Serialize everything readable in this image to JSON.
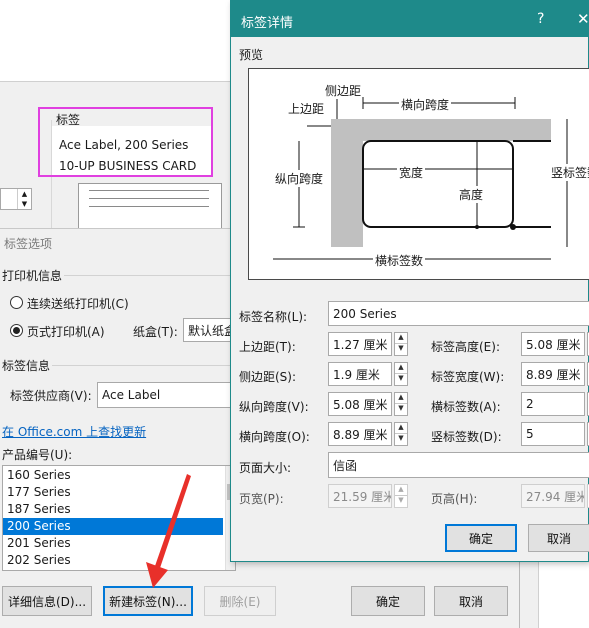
{
  "back_window": {
    "labels_group_title": "标签",
    "selected_label_line1": "Ace Label, 200 Series",
    "selected_label_line2": "10-UP BUSINESS CARD"
  },
  "label_options": {
    "title": "标签选项",
    "printer_info": "打印机信息",
    "continuous_printer": "连续送纸打印机(C)",
    "page_printer": "页式打印机(A)",
    "tray_label": "纸盒(T):",
    "tray_value": "默认纸盒",
    "label_info": "标签信息",
    "vendor_label": "标签供应商(V):",
    "vendor_value": "Ace Label",
    "office_link": "在 Office.com 上查找更新",
    "product_number_label": "产品编号(U):",
    "product_list": [
      "160 Series",
      "177 Series",
      "187 Series",
      "200 Series",
      "201 Series",
      "202 Series"
    ],
    "selected_index": 3,
    "details_button": "详细信息(D)...",
    "new_label_button": "新建标签(N)...",
    "delete_button": "删除(E)",
    "ok_button": "确定",
    "cancel_button": "取消"
  },
  "label_details": {
    "title": "标签详情",
    "help_icon": "?",
    "close_icon": "✕",
    "preview_group": "预览",
    "preview": {
      "top_margin": "上边距",
      "side_margin": "侧边距",
      "horizontal_pitch": "横向跨度",
      "vertical_pitch": "纵向跨度",
      "width": "宽度",
      "height": "高度",
      "number_across": "横标签数",
      "number_down": "竖标签数"
    },
    "label_name_label": "标签名称(L):",
    "label_name_value": "200 Series",
    "top_margin_label": "上边距(T):",
    "top_margin_value": "1.27 厘米",
    "side_margin_label": "侧边距(S):",
    "side_margin_value": "1.9 厘米",
    "vertical_pitch_label": "纵向跨度(V):",
    "vertical_pitch_value": "5.08 厘米",
    "horizontal_pitch_label": "横向跨度(O):",
    "horizontal_pitch_value": "8.89 厘米",
    "label_height_label": "标签高度(E):",
    "label_height_value": "5.08 厘米",
    "label_width_label": "标签宽度(W):",
    "label_width_value": "8.89 厘米",
    "number_across_label": "横标签数(A):",
    "number_across_value": "2",
    "number_down_label": "竖标签数(D):",
    "number_down_value": "5",
    "page_size_label": "页面大小:",
    "page_size_value": "信函",
    "page_width_label": "页宽(P):",
    "page_width_value": "21.59 厘米",
    "page_height_label": "页高(H):",
    "page_height_value": "27.94 厘米",
    "ok_button": "确定",
    "cancel_button": "取消"
  },
  "colors": {
    "title_bar": "#1e8a8a",
    "highlight_box": "#e040e0",
    "red_arrow": "#e8302a",
    "link": "#0563c1",
    "selection": "#0078d7"
  }
}
